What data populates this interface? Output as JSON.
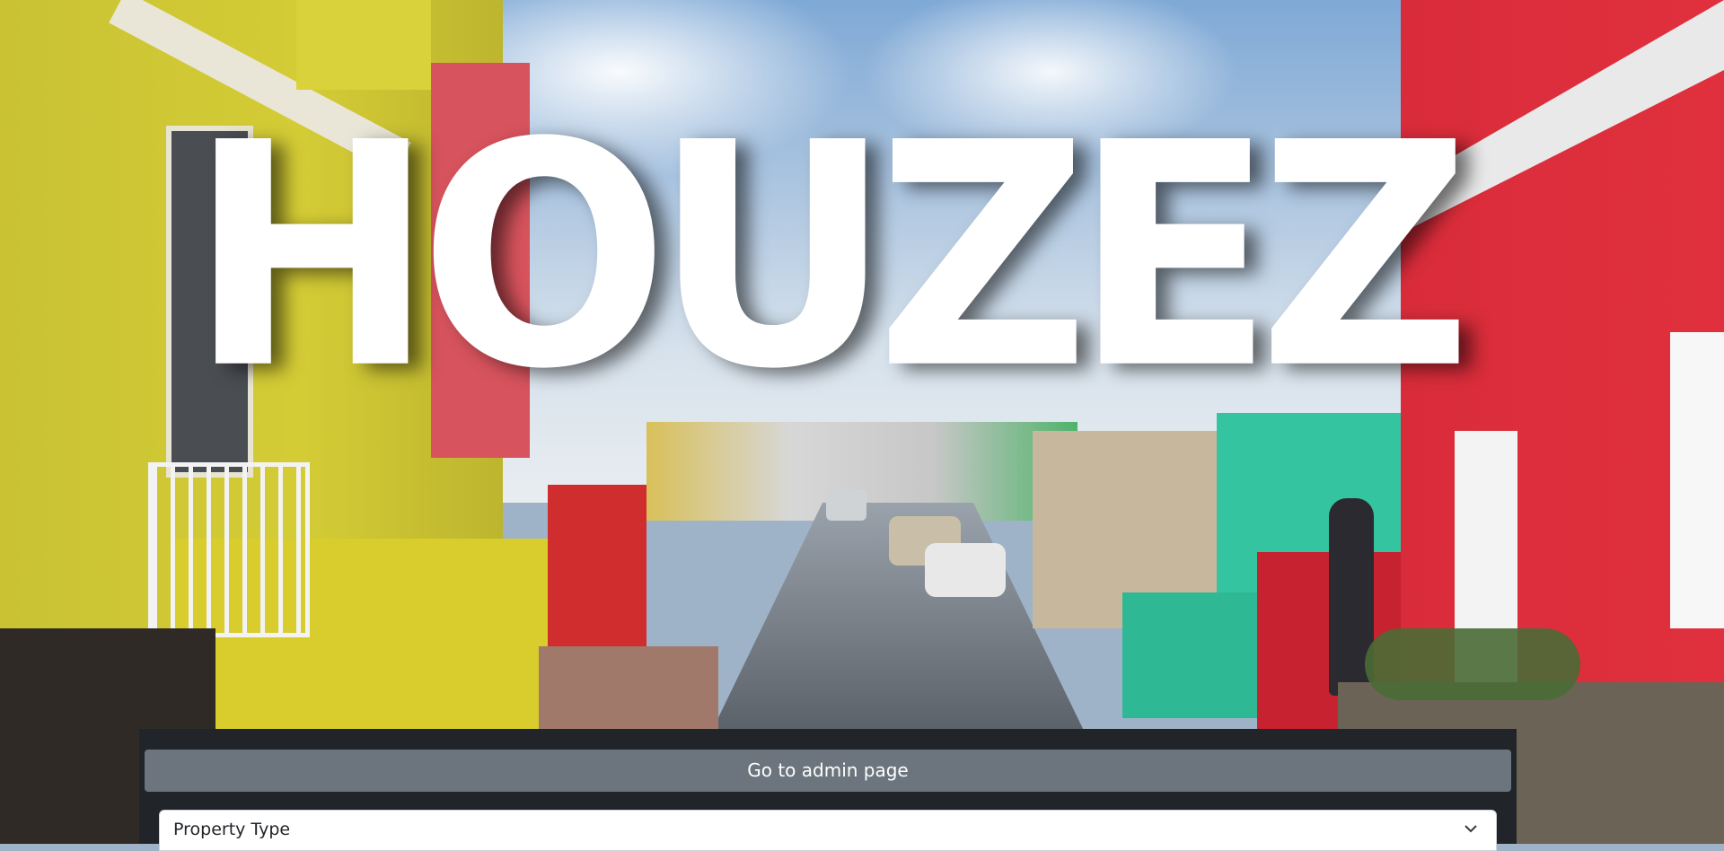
{
  "hero": {
    "title": "HOUZEZ"
  },
  "panel": {
    "admin_button_label": "Go to admin page",
    "property_type_select": {
      "selected": "Property Type",
      "icon": "chevron-down-icon"
    }
  },
  "colors": {
    "panel_background": "#212529",
    "button_background": "#6c757d",
    "title_color": "#ffffff"
  }
}
